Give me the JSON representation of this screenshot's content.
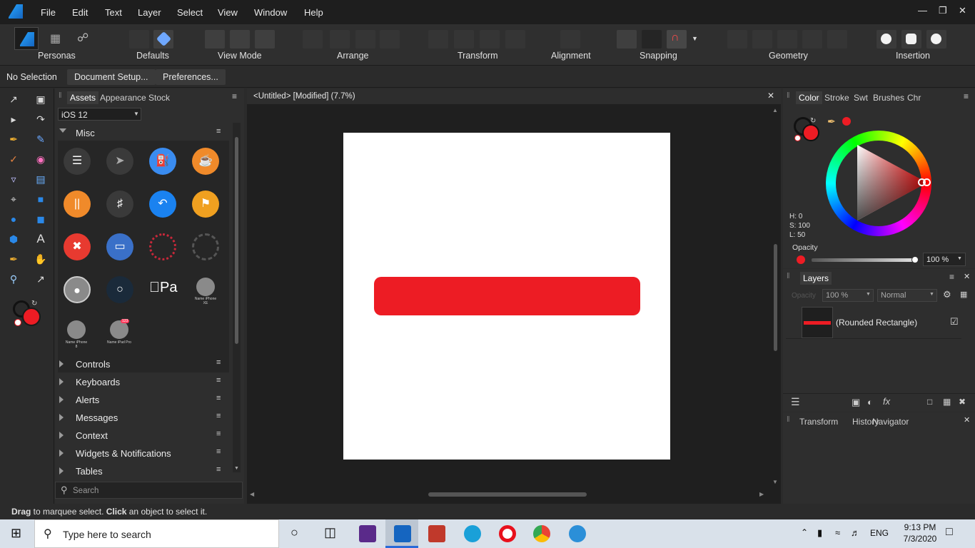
{
  "menu": [
    "File",
    "Edit",
    "Text",
    "Layer",
    "Select",
    "View",
    "Window",
    "Help"
  ],
  "toolbar_groups": [
    "Personas",
    "Defaults",
    "View Mode",
    "Arrange",
    "Transform",
    "Alignment",
    "Snapping",
    "Geometry",
    "Insertion"
  ],
  "context": {
    "selection": "No Selection",
    "doc_setup": "Document Setup...",
    "preferences": "Preferences..."
  },
  "assets": {
    "tabs": [
      "Assets",
      "Appearance",
      "Stock"
    ],
    "library": "iOS 12",
    "open_category": "Misc",
    "categories": [
      "Controls",
      "Keyboards",
      "Alerts",
      "Messages",
      "Context",
      "Widgets & Notifications",
      "Tables"
    ],
    "search_placeholder": "Search",
    "apple_pay_text": "Pa",
    "name_labels": [
      "Name iPhone XE",
      "Name iPhone 8",
      "Name iPad Pro"
    ],
    "badge": "123"
  },
  "document": {
    "tab_title": "<Untitled> [Modified] (7.7%)"
  },
  "color": {
    "tabs": [
      "Color",
      "Stroke",
      "Swt",
      "Brushes",
      "Chr"
    ],
    "h": "H: 0",
    "s": "S: 100",
    "l": "L: 50",
    "opacity_label": "Opacity",
    "opacity_value": "100 %",
    "accent": "#ed1c24"
  },
  "layers": {
    "title": "Layers",
    "opacity_label": "Opacity",
    "opacity_value": "100 %",
    "blend": "Normal",
    "item": "(Rounded Rectangle)"
  },
  "bottom_tabs": [
    "Transform",
    "History",
    "Navigator"
  ],
  "status": {
    "drag": "Drag",
    "drag_text": " to marquee select. ",
    "click": "Click",
    "click_text": " an object to select it."
  },
  "taskbar": {
    "search_placeholder": "Type here to search",
    "lang": "ENG",
    "time": "9:13 PM",
    "date": "7/3/2020"
  }
}
